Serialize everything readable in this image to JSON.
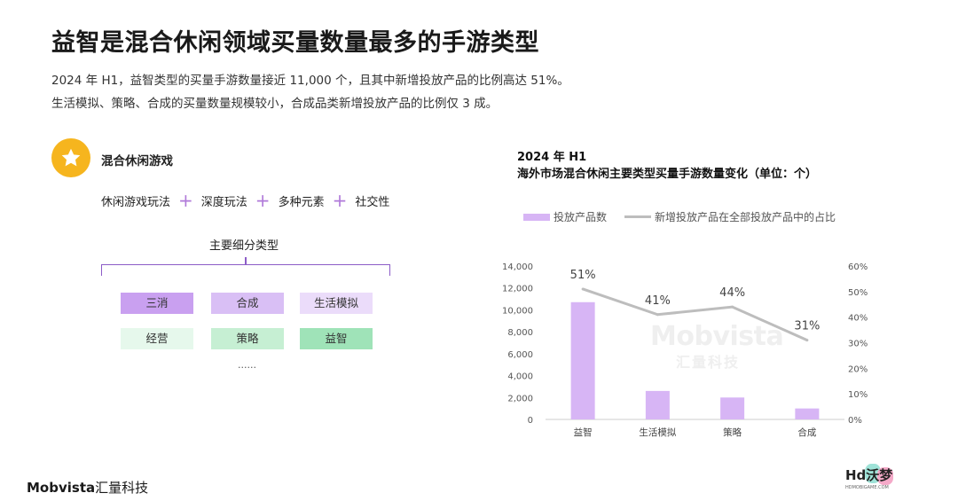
{
  "page": {
    "title": "益智是混合休闲领域买量数量最多的手游类型",
    "desc1": "2024 年 H1，益智类型的买量手游数量接近 11,000 个，且其中新增投放产品的比例高达 51%。",
    "desc2": "生活模拟、策略、合成的买量数量规模较小，合成品类新增投放产品的比例仅 3 成。"
  },
  "left": {
    "section_title": "混合休闲游戏",
    "formula": [
      "休闲游戏玩法",
      "深度玩法",
      "多种元素",
      "社交性"
    ],
    "subtypes_title": "主要细分类型",
    "tags_row1": [
      {
        "label": "三消",
        "color": "#c9a0f0"
      },
      {
        "label": "合成",
        "color": "#d9bff5"
      },
      {
        "label": "生活模拟",
        "color": "#ebdcfa"
      }
    ],
    "tags_row2": [
      {
        "label": "经营",
        "color": "#e6f8ec"
      },
      {
        "label": "策略",
        "color": "#c6efd3"
      },
      {
        "label": "益智",
        "color": "#9fe3b8"
      }
    ],
    "ellipsis": "......"
  },
  "chart_header": {
    "line1": "2024 年 H1",
    "line2": "海外市场混合休闲主要类型买量手游数量变化（单位：个）"
  },
  "chart_data": {
    "type": "bar",
    "categories": [
      "益智",
      "生活模拟",
      "策略",
      "合成"
    ],
    "series": [
      {
        "name": "投放产品数",
        "type": "bar",
        "axis": "left",
        "values": [
          10700,
          2600,
          2000,
          1000
        ],
        "color": "#d7b5f5"
      },
      {
        "name": "新增投放产品在全部投放产品中的占比",
        "type": "line",
        "axis": "right",
        "values": [
          0.51,
          0.41,
          0.44,
          0.31
        ],
        "labels": [
          "51%",
          "41%",
          "44%",
          "31%"
        ],
        "color": "#bdbdbd"
      }
    ],
    "y_left": {
      "min": 0,
      "max": 14000,
      "ticks": [
        "0",
        "2,000",
        "4,000",
        "6,000",
        "8,000",
        "10,000",
        "12,000",
        "14,000"
      ]
    },
    "y_right": {
      "min": 0,
      "max": 0.6,
      "ticks": [
        "0%",
        "10%",
        "20%",
        "30%",
        "40%",
        "50%",
        "60%"
      ]
    },
    "legend_position": "top-left",
    "grid": false
  },
  "watermark": {
    "line1": "Mobvista",
    "line2": "汇量科技"
  },
  "footer": {
    "logo_en": "Mobvista",
    "logo_cn": "汇量科技",
    "hd_logo": "Hd沃梦",
    "hd_small": "HDMOBIGAME.COM"
  }
}
